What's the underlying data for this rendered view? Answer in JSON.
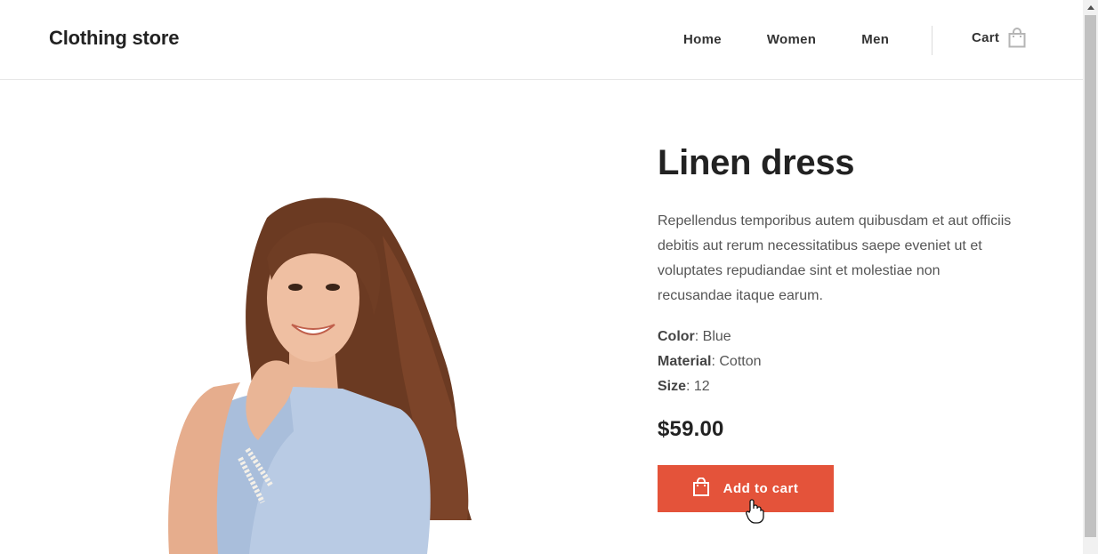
{
  "header": {
    "brand": "Clothing store",
    "nav": [
      {
        "label": "Home"
      },
      {
        "label": "Women"
      },
      {
        "label": "Men"
      }
    ],
    "cart_label": "Cart",
    "cart_icon": "shopping-bag-icon"
  },
  "product": {
    "title": "Linen dress",
    "description": "Repellendus temporibus autem quibusdam et aut officiis debitis aut rerum necessitatibus saepe eveniet ut et voluptates repudiandae sint et molestiae non recusandae itaque earum.",
    "attributes": [
      {
        "name": "Color",
        "value": "Blue"
      },
      {
        "name": "Material",
        "value": "Cotton"
      },
      {
        "name": "Size",
        "value": "12"
      }
    ],
    "price": "$59.00",
    "add_to_cart_label": "Add to cart",
    "add_to_cart_icon": "shopping-bag-icon"
  },
  "colors": {
    "accent": "#e4533a",
    "text_dark": "#222222",
    "text_body": "#555555"
  }
}
